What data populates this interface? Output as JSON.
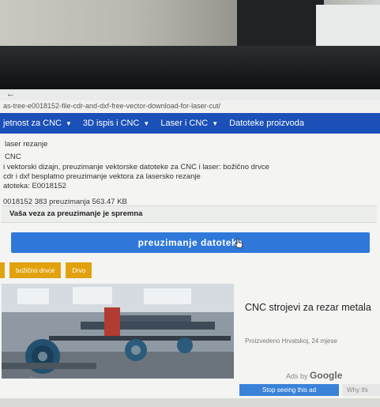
{
  "browser": {
    "top_text": "←",
    "url": "as-tree-e0018152-file-cdr-and-dxf-free-vector-download-for-laser-cut/"
  },
  "nav": {
    "items": [
      {
        "label": "jetnost za CNC",
        "caret": "▼"
      },
      {
        "label": "3D ispis i CNC",
        "caret": "▼"
      },
      {
        "label": "Laser i CNC",
        "caret": "▼"
      },
      {
        "label": "Datoteke proizvoda",
        "caret": ""
      }
    ]
  },
  "content": {
    "category": "laser rezanje",
    "cnc": "CNC",
    "desc_line1": "i vektorski dizajn, preuzimanje vektorske datoteke za CNC i laser: božično drvce",
    "desc_line2": "cdr i dxf besplatno preuzimanje vektora za lasersko rezanje",
    "file_id": "atoteka: E0018152",
    "stats": "0018152 383 preuzimanja  563.47 KB"
  },
  "download": {
    "ready_text": "Vaša veza za preuzimanje je spremna",
    "button_label": "preuzimanje datoteka"
  },
  "tags": [
    "božično drvce",
    "Drvo"
  ],
  "ad": {
    "title": "CNC strojevi za rezar metala",
    "subtitle": "Proizvedeno Hrvatskoj, 24 mjese",
    "ads_by": "Ads by",
    "google": "Google",
    "stop_label": "Stop seeing this ad",
    "why_label": "Why thi"
  },
  "colors": {
    "nav_bg": "#1a50b7",
    "button_bg": "#2f78d9",
    "tag_bg": "#e2a20e"
  }
}
